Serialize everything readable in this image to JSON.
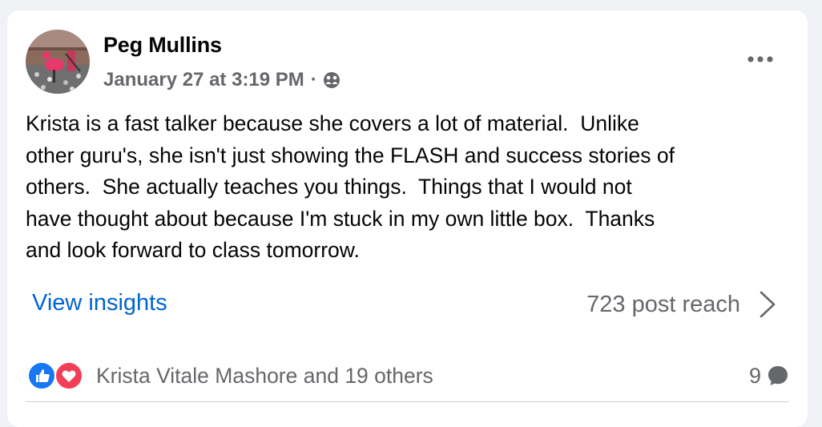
{
  "post": {
    "author": "Peg Mullins",
    "date": "January 27 at 3:19 PM",
    "separator": "·",
    "audience_icon": "friends-icon",
    "more_icon": "more-options-icon",
    "text": "Krista is a fast talker because she covers a lot of material.  Unlike\nother guru's, she isn't just showing the FLASH and success stories of\nothers.  She actually teaches you things.  Things that I would not\nhave thought about because I'm stuck in my own little box.  Thanks\nand look forward to class tomorrow."
  },
  "insights": {
    "link_label": "View insights",
    "reach_text": "723 post reach",
    "chevron_icon": "chevron-right-icon"
  },
  "engagement": {
    "reaction_icons": [
      "like-icon",
      "love-icon"
    ],
    "reactors_text": "Krista Vitale Mashore and 19 others",
    "comment_count": "9",
    "comment_icon": "comment-bubble-icon"
  },
  "colors": {
    "link": "#0064d1",
    "secondary_text": "#65676b",
    "like_blue": "#1877f2",
    "love_red": "#f33e58",
    "background": "#f0f2f5"
  }
}
